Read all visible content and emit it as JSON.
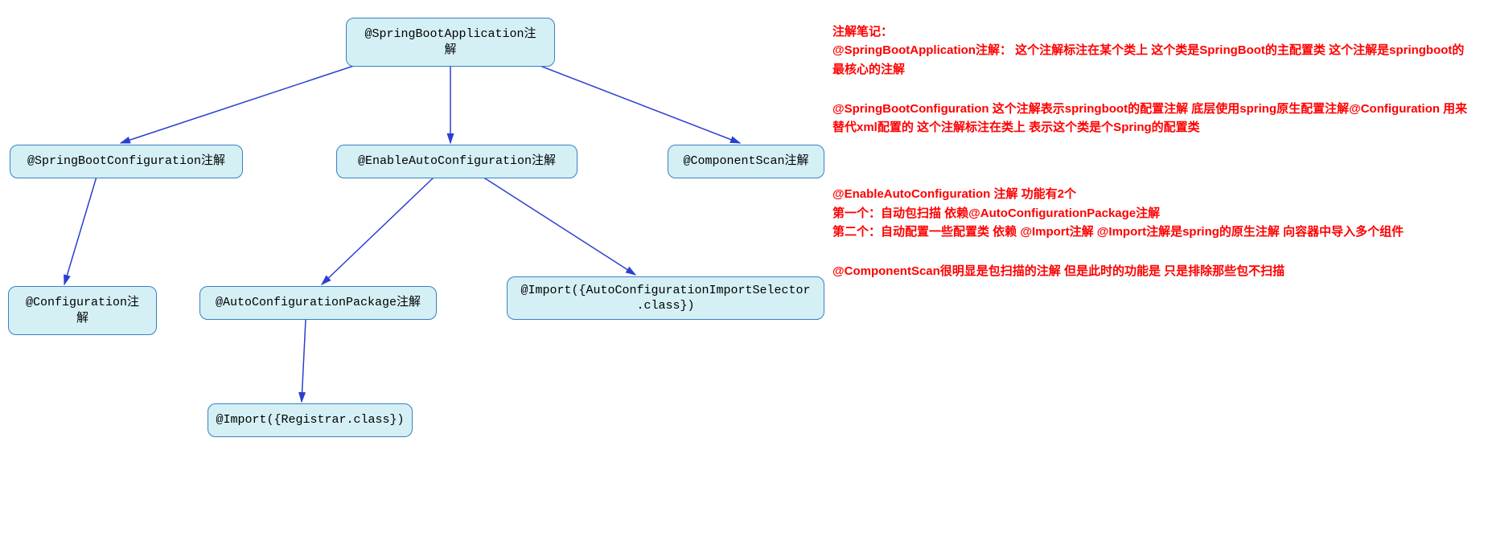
{
  "nodes": {
    "root": "@SpringBootApplication注解",
    "config": "@SpringBootConfiguration注解",
    "enable": "@EnableAutoConfiguration注解",
    "componentScan": "@ComponentScan注解",
    "configuration": "@Configuration注解",
    "autoPkg": "@AutoConfigurationPackage注解",
    "importSelector": "@Import({AutoConfigurationImportSelector\n.class})",
    "registrar": "@Import({Registrar.class})"
  },
  "notes": {
    "p1": "注解笔记：\n@SpringBootApplication注解： 这个注解标注在某个类上 这个类是SpringBoot的主配置类  这个注解是springboot的 最核心的注解",
    "p2": "@SpringBootConfiguration 这个注解表示springboot的配置注解 底层使用spring原生配置注解@Configuration  用来替代xml配置的  这个注解标注在类上 表示这个类是个Spring的配置类",
    "p3": "@EnableAutoConfiguration 注解  功能有2个\n第一个：自动包扫描  依赖@AutoConfigurationPackage注解\n第二个：自动配置一些配置类 依赖 @Import注解  @Import注解是spring的原生注解 向容器中导入多个组件",
    "p4": "@ComponentScan很明显是包扫描的注解 但是此时的功能是 只是排除那些包不扫描"
  },
  "colors": {
    "nodeFill": "#d4f0f5",
    "nodeBorder": "#3a7fc4",
    "connector": "#2a3fd0",
    "noteText": "#ff0000"
  }
}
